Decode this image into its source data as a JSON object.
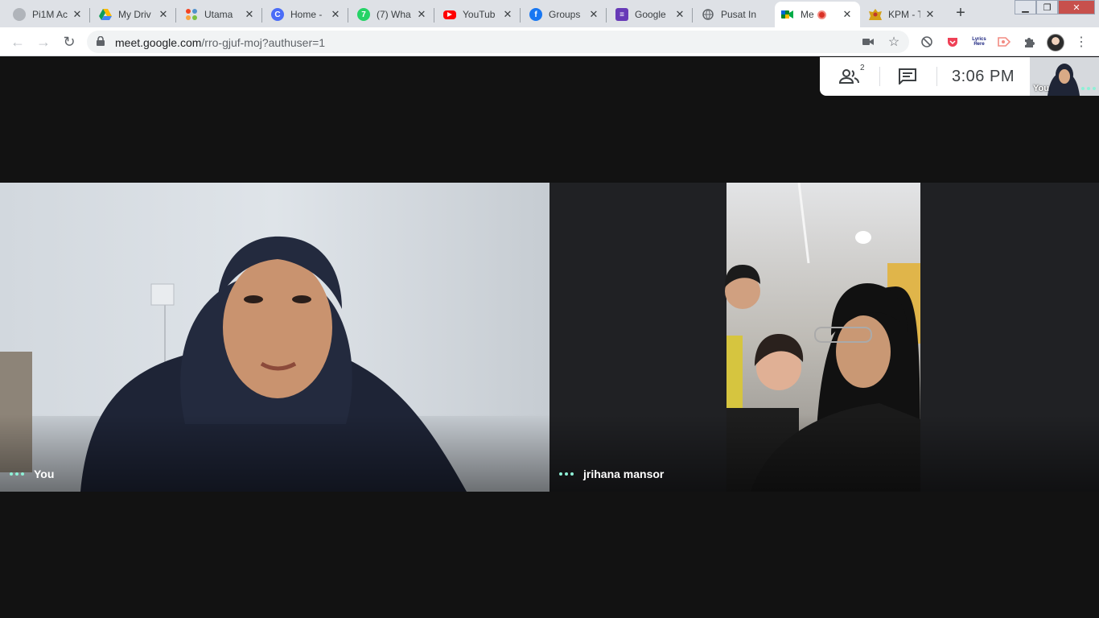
{
  "browser": {
    "tabs": [
      {
        "title": "Pi1M Ac",
        "icon": "pi1m-icon",
        "color": "#8a8f98"
      },
      {
        "title": "My Driv",
        "icon": "drive-icon",
        "color": "#1a73e8"
      },
      {
        "title": "Utama",
        "icon": "joomla-icon",
        "color": "#e44d26"
      },
      {
        "title": "Home -",
        "icon": "canva-icon",
        "color": "#4a6cf7"
      },
      {
        "title": "(7) Wha",
        "icon": "whatsapp-icon",
        "color": "#25d366"
      },
      {
        "title": "YouTub",
        "icon": "youtube-icon",
        "color": "#ff0000"
      },
      {
        "title": "Groups",
        "icon": "facebook-icon",
        "color": "#1877f2"
      },
      {
        "title": "Google",
        "icon": "forms-icon",
        "color": "#673ab7"
      },
      {
        "title": "Pusat In",
        "icon": "globe-icon",
        "color": "#5f6368"
      },
      {
        "title": "Me",
        "icon": "meet-icon",
        "color": "#00832d",
        "active": true,
        "recording": true
      },
      {
        "title": "KPM - T",
        "icon": "kpm-crest-icon",
        "color": "#d4a017"
      }
    ],
    "address": {
      "domain": "meet.google.com",
      "path": "/rro-gjuf-moj?authuser=1"
    },
    "extension_lyrics_label": "Lyrics Here"
  },
  "meet": {
    "participant_count": "2",
    "time": "3:06 PM",
    "self_thumb_label": "You",
    "tiles": [
      {
        "name": "You"
      },
      {
        "name": "jrihana mansor"
      }
    ]
  },
  "colors": {
    "background": "#121212",
    "speaking_dots": "#8ef0d6",
    "record": "#d93025"
  }
}
